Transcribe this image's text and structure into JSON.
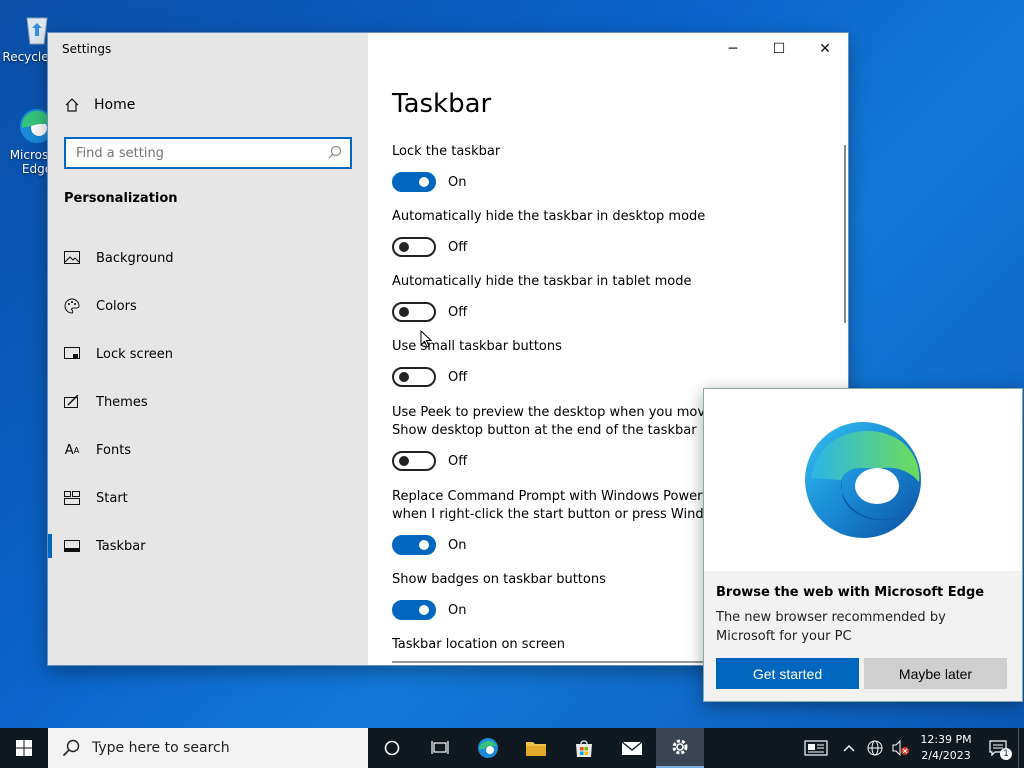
{
  "desktop": {
    "icons": [
      {
        "label": "Recycle Bin"
      },
      {
        "label": "Microsoft Edge"
      }
    ]
  },
  "window": {
    "title": "Settings",
    "controls": {
      "minimize": "─",
      "maximize": "☐",
      "close": "✕"
    }
  },
  "nav": {
    "home_label": "Home",
    "search_placeholder": "Find a setting",
    "section": "Personalization",
    "items": [
      {
        "label": "Background",
        "icon": "image-icon"
      },
      {
        "label": "Colors",
        "icon": "palette-icon"
      },
      {
        "label": "Lock screen",
        "icon": "lock-screen-icon"
      },
      {
        "label": "Themes",
        "icon": "themes-icon"
      },
      {
        "label": "Fonts",
        "icon": "fonts-icon"
      },
      {
        "label": "Start",
        "icon": "start-icon"
      },
      {
        "label": "Taskbar",
        "icon": "taskbar-icon"
      }
    ],
    "active_item": "Taskbar"
  },
  "content": {
    "title": "Taskbar",
    "settings": [
      {
        "label": "Lock the taskbar",
        "state": "On"
      },
      {
        "label": "Automatically hide the taskbar in desktop mode",
        "state": "Off"
      },
      {
        "label": "Automatically hide the taskbar in tablet mode",
        "state": "Off"
      },
      {
        "label": "Use small taskbar buttons",
        "state": "Off"
      },
      {
        "label": "Use Peek to preview the desktop when you move y",
        "label2": "Show desktop button at the end of the taskbar",
        "state": "Off"
      },
      {
        "label": "Replace Command Prompt with Windows PowerSh",
        "label2": "when I right-click the start button or press Windov",
        "state": "On"
      },
      {
        "label": "Show badges on taskbar buttons",
        "state": "On"
      }
    ],
    "location_label": "Taskbar location on screen"
  },
  "edge_popup": {
    "title": "Browse the web with Microsoft Edge",
    "text": "The new browser recommended by Microsoft for your PC",
    "primary": "Get started",
    "secondary": "Maybe later"
  },
  "taskbar": {
    "search_placeholder": "Type here to search",
    "time": "12:39 PM",
    "date": "2/4/2023",
    "notification_count": "1"
  }
}
